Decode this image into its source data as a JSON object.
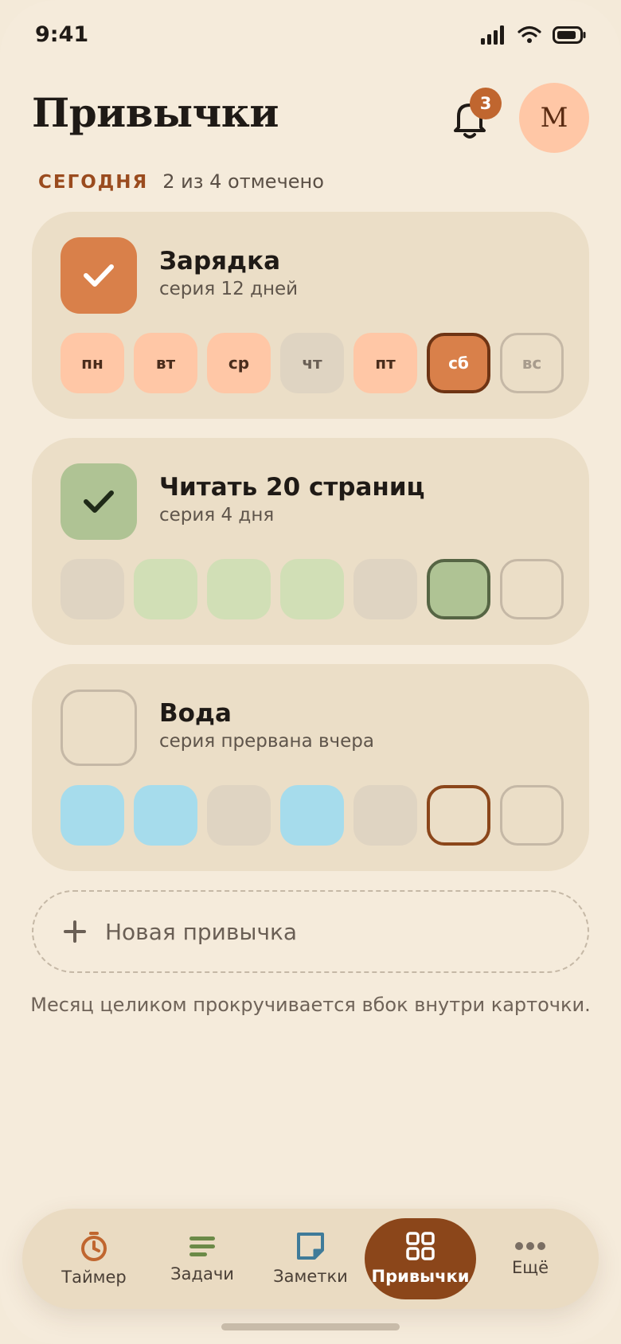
{
  "status": {
    "time": "9:41"
  },
  "header": {
    "title": "Привычки",
    "notifications_count": "3",
    "avatar_initial": "М"
  },
  "today": {
    "label": "СЕГОДНЯ",
    "count_text": "2 из 4 отмечено"
  },
  "habits": [
    {
      "name": "Зарядка",
      "subtitle": "серия 12 дней",
      "checked": true,
      "accent": "#d9804a",
      "days": [
        {
          "label": "пн",
          "state": "done"
        },
        {
          "label": "вт",
          "state": "done"
        },
        {
          "label": "ср",
          "state": "done"
        },
        {
          "label": "чт",
          "state": "missed"
        },
        {
          "label": "пт",
          "state": "done"
        },
        {
          "label": "сб",
          "state": "today-done"
        },
        {
          "label": "вс",
          "state": "future"
        }
      ]
    },
    {
      "name": "Читать 20 страниц",
      "subtitle": "серия 4 дня",
      "checked": true,
      "accent": "#afc394",
      "days": [
        {
          "label": "",
          "state": "missed"
        },
        {
          "label": "",
          "state": "done"
        },
        {
          "label": "",
          "state": "done"
        },
        {
          "label": "",
          "state": "done"
        },
        {
          "label": "",
          "state": "missed"
        },
        {
          "label": "",
          "state": "today-done"
        },
        {
          "label": "",
          "state": "future"
        }
      ]
    },
    {
      "name": "Вода",
      "subtitle": "серия прервана вчера",
      "checked": false,
      "accent": "#a6dcec",
      "days": [
        {
          "label": "",
          "state": "done"
        },
        {
          "label": "",
          "state": "done"
        },
        {
          "label": "",
          "state": "missed"
        },
        {
          "label": "",
          "state": "done"
        },
        {
          "label": "",
          "state": "missed"
        },
        {
          "label": "",
          "state": "today-open"
        },
        {
          "label": "",
          "state": "future"
        }
      ]
    }
  ],
  "add_habit": {
    "label": "Новая привычка"
  },
  "hint": "Месяц целиком прокручивается вбок внутри карточки.",
  "tabbar": {
    "tabs": [
      {
        "label": "Таймер",
        "icon": "timer-icon",
        "active": false
      },
      {
        "label": "Задачи",
        "icon": "tasks-icon",
        "active": false
      },
      {
        "label": "Заметки",
        "icon": "notes-icon",
        "active": false
      },
      {
        "label": "Привычки",
        "icon": "habits-grid-icon",
        "active": true
      },
      {
        "label": "Ещё",
        "icon": "more-dots-icon",
        "active": false
      }
    ]
  },
  "colors": {
    "background": "#f5ebdb",
    "card": "#ebdec7",
    "brand": "#8b461a",
    "orange": "#d9804a",
    "green": "#afc394",
    "blue": "#a6dcec"
  }
}
